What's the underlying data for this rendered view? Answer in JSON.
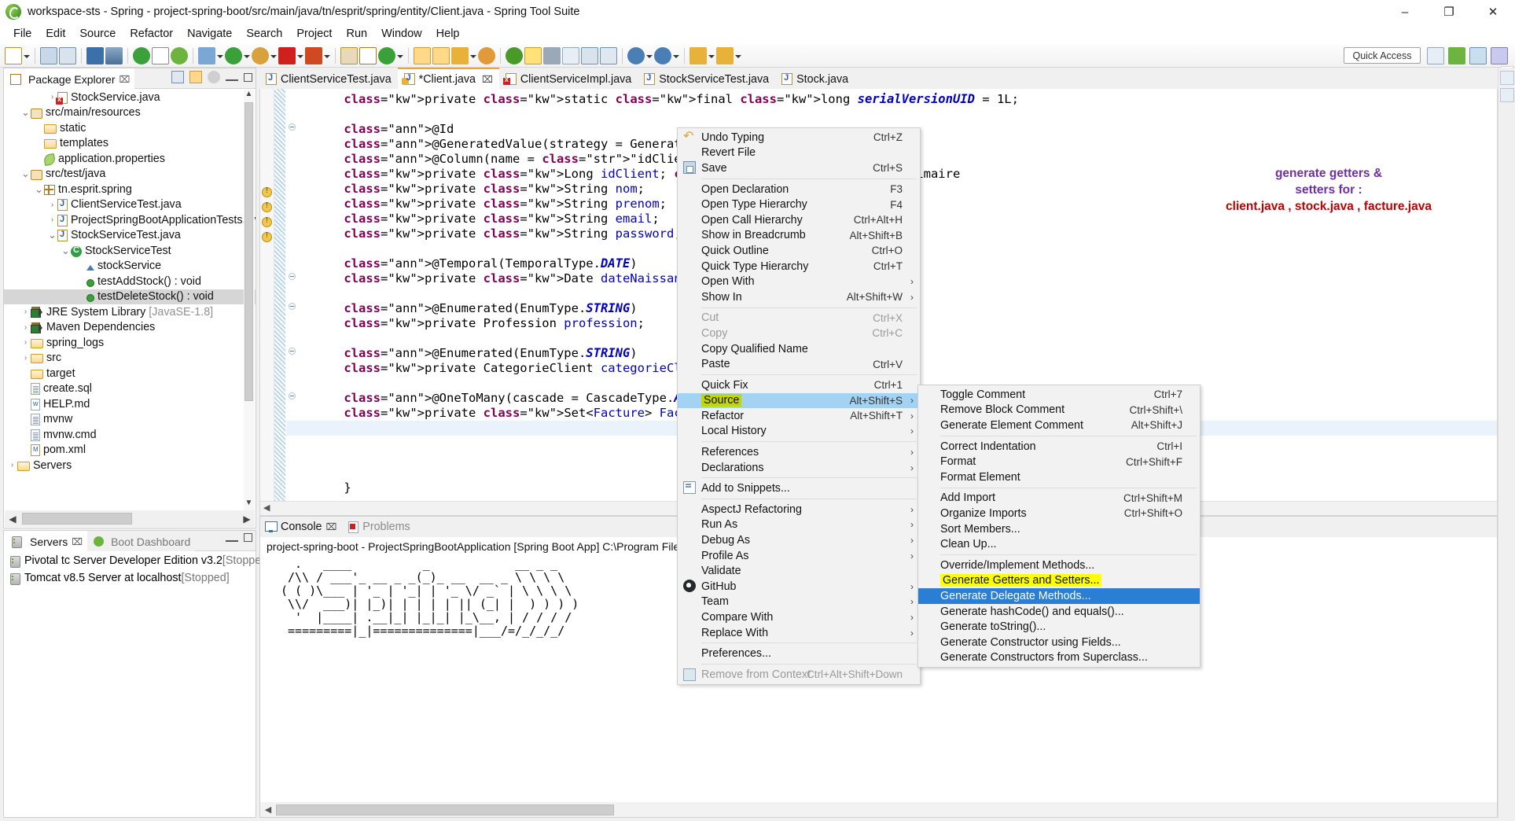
{
  "window": {
    "title": "workspace-sts - Spring - project-spring-boot/src/main/java/tn/esprit/spring/entity/Client.java - Spring Tool Suite",
    "minimize": "–",
    "maximize": "❐",
    "close": "✕"
  },
  "menubar": [
    "File",
    "Edit",
    "Source",
    "Refactor",
    "Navigate",
    "Search",
    "Project",
    "Run",
    "Window",
    "Help"
  ],
  "toolbar": {
    "quick_access": "Quick Access"
  },
  "package_explorer": {
    "tab_label": "Package Explorer",
    "tab_close": "⌧",
    "tree": [
      {
        "indent": 3,
        "twisty": ">",
        "icon": "java-error-icon",
        "label": "StockService.java"
      },
      {
        "indent": 1,
        "twisty": "v",
        "icon": "package-folder-icon",
        "label": "src/main/resources"
      },
      {
        "indent": 2,
        "twisty": "",
        "icon": "folder-open-icon",
        "label": "static"
      },
      {
        "indent": 2,
        "twisty": "",
        "icon": "folder-open-icon",
        "label": "templates"
      },
      {
        "indent": 2,
        "twisty": "",
        "icon": "properties-icon",
        "label": "application.properties"
      },
      {
        "indent": 1,
        "twisty": "v",
        "icon": "package-folder-icon",
        "label": "src/test/java"
      },
      {
        "indent": 2,
        "twisty": "v",
        "icon": "package-icon",
        "label": "tn.esprit.spring"
      },
      {
        "indent": 3,
        "twisty": ">",
        "icon": "java-icon",
        "label": "ClientServiceTest.java"
      },
      {
        "indent": 3,
        "twisty": ">",
        "icon": "java-icon",
        "label": "ProjectSpringBootApplicationTests.java"
      },
      {
        "indent": 3,
        "twisty": "v",
        "icon": "java-icon",
        "label": "StockServiceTest.java"
      },
      {
        "indent": 4,
        "twisty": "v",
        "icon": "class-icon",
        "label": "StockServiceTest"
      },
      {
        "indent": 5,
        "twisty": "",
        "icon": "field-icon",
        "label": "stockService"
      },
      {
        "indent": 5,
        "twisty": "",
        "icon": "method-icon",
        "label": "testAddStock() : void",
        "dim_suffix": ""
      },
      {
        "indent": 5,
        "twisty": "",
        "icon": "method-icon",
        "label": "testDeleteStock() : void",
        "selected": true
      },
      {
        "indent": 1,
        "twisty": ">",
        "icon": "library-icon",
        "label": "JRE System Library ",
        "dim_suffix": "[JavaSE-1.8]"
      },
      {
        "indent": 1,
        "twisty": ">",
        "icon": "library-icon",
        "label": "Maven Dependencies"
      },
      {
        "indent": 1,
        "twisty": ">",
        "icon": "folder-open-icon",
        "label": "spring_logs"
      },
      {
        "indent": 1,
        "twisty": ">",
        "icon": "folder-error-icon",
        "label": "src"
      },
      {
        "indent": 1,
        "twisty": "",
        "icon": "folder-open-icon",
        "label": "target"
      },
      {
        "indent": 1,
        "twisty": "",
        "icon": "file-icon",
        "label": "create.sql"
      },
      {
        "indent": 1,
        "twisty": "",
        "icon": "md-icon",
        "label": "HELP.md"
      },
      {
        "indent": 1,
        "twisty": "",
        "icon": "file-icon",
        "label": "mvnw"
      },
      {
        "indent": 1,
        "twisty": "",
        "icon": "file-icon",
        "label": "mvnw.cmd"
      },
      {
        "indent": 1,
        "twisty": "",
        "icon": "xml-icon",
        "label": "pom.xml"
      },
      {
        "indent": 0,
        "twisty": ">",
        "icon": "folder-open-icon",
        "label": "Servers"
      }
    ]
  },
  "servers_panel": {
    "tabs": [
      {
        "label": "Servers",
        "active": true,
        "close": "⌧"
      },
      {
        "label": "Boot Dashboard",
        "active": false
      }
    ],
    "rows": [
      {
        "name": "Pivotal tc Server Developer Edition v3.2 ",
        "status": "[Stopped]"
      },
      {
        "name": "Tomcat v8.5 Server at localhost ",
        "status": "[Stopped]"
      }
    ]
  },
  "editor": {
    "tabs": [
      {
        "label": "ClientServiceTest.java",
        "icon": "java-icon",
        "active": false,
        "close": false
      },
      {
        "label": "*Client.java",
        "icon": "java-warn-icon",
        "active": true,
        "close": true
      },
      {
        "label": "ClientServiceImpl.java",
        "icon": "java-error-icon",
        "active": false,
        "close": false
      },
      {
        "label": "StockServiceTest.java",
        "icon": "java-icon",
        "active": false,
        "close": false
      },
      {
        "label": "Stock.java",
        "icon": "java-icon",
        "active": false,
        "close": false
      }
    ],
    "code_lines": [
      "    private static final long serialVersionUID = 1L;",
      "",
      "    @Id",
      "    @GeneratedValue(strategy = GenerationType.IDENTITY)",
      "    @Column(name = \"idClient\")",
      "    private Long idClient; // Clé primaire",
      "    private String nom;",
      "    private String prenom;",
      "    private String email;",
      "    private String password;",
      "",
      "    @Temporal(TemporalType.DATE)",
      "    private Date dateNaissance;",
      "",
      "    @Enumerated(EnumType.STRING)",
      "    private Profession profession;",
      "",
      "    @Enumerated(EnumType.STRING)",
      "    private CategorieClient categorieClient;",
      "",
      "    @OneToMany(cascade = CascadeType.ALL, mappedBy = \"Cl",
      "    private Set<Facture> Facture;",
      "",
      "",
      "",
      "",
      "    }"
    ]
  },
  "annotation": {
    "line1": "generate getters &",
    "line2": "setters for :",
    "line3": "client.java , stock.java , facture.java"
  },
  "console": {
    "tabs": [
      {
        "label": "Console",
        "active": true,
        "close": "⌧",
        "icon": "console-icon"
      },
      {
        "label": "Problems",
        "active": false,
        "icon": "problems-icon"
      }
    ],
    "header": "project-spring-boot - ProjectSpringBootApplication [Spring Boot App] C:\\Program Files\\Java\\jdk1",
    "art": [
      "  .   ____          _            __ _ _",
      " /\\\\ / ___'_ __ _ _(_)_ __  __ _ \\ \\ \\ \\",
      "( ( )\\___ | '_ | '_| | '_ \\/ _` | \\ \\ \\ \\",
      " \\\\/  ___)| |_)| | | | | || (_| |  ) ) ) )",
      "  '  |____| .__|_| |_|_| |_\\__, | / / / /",
      " =========|_|==============|___/=/_/_/_/"
    ]
  },
  "context_menu": {
    "items": [
      {
        "label": "Undo Typing",
        "shortcut": "Ctrl+Z",
        "icon": "undo-icon"
      },
      {
        "label": "Revert File",
        "shortcut": ""
      },
      {
        "label": "Save",
        "shortcut": "Ctrl+S",
        "icon": "save-icon"
      },
      {
        "sep": true
      },
      {
        "label": "Open Declaration",
        "shortcut": "F3"
      },
      {
        "label": "Open Type Hierarchy",
        "shortcut": "F4"
      },
      {
        "label": "Open Call Hierarchy",
        "shortcut": "Ctrl+Alt+H"
      },
      {
        "label": "Show in Breadcrumb",
        "shortcut": "Alt+Shift+B"
      },
      {
        "label": "Quick Outline",
        "shortcut": "Ctrl+O"
      },
      {
        "label": "Quick Type Hierarchy",
        "shortcut": "Ctrl+T"
      },
      {
        "label": "Open With",
        "shortcut": "",
        "submenu": true
      },
      {
        "label": "Show In",
        "shortcut": "Alt+Shift+W",
        "submenu": true
      },
      {
        "sep": true
      },
      {
        "label": "Cut",
        "shortcut": "Ctrl+X",
        "disabled": true
      },
      {
        "label": "Copy",
        "shortcut": "Ctrl+C",
        "disabled": true
      },
      {
        "label": "Copy Qualified Name",
        "shortcut": ""
      },
      {
        "label": "Paste",
        "shortcut": "Ctrl+V"
      },
      {
        "sep": true
      },
      {
        "label": "Quick Fix",
        "shortcut": "Ctrl+1"
      },
      {
        "label": "Source",
        "shortcut": "Alt+Shift+S",
        "submenu": true,
        "selected": true,
        "highlight": "green"
      },
      {
        "label": "Refactor",
        "shortcut": "Alt+Shift+T",
        "submenu": true
      },
      {
        "label": "Local History",
        "shortcut": "",
        "submenu": true
      },
      {
        "sep": true
      },
      {
        "label": "References",
        "shortcut": "",
        "submenu": true
      },
      {
        "label": "Declarations",
        "shortcut": "",
        "submenu": true
      },
      {
        "sep": true
      },
      {
        "label": "Add to Snippets...",
        "shortcut": "",
        "icon": "snippet-icon"
      },
      {
        "sep": true
      },
      {
        "label": "AspectJ Refactoring",
        "shortcut": "",
        "submenu": true
      },
      {
        "label": "Run As",
        "shortcut": "",
        "submenu": true
      },
      {
        "label": "Debug As",
        "shortcut": "",
        "submenu": true
      },
      {
        "label": "Profile As",
        "shortcut": "",
        "submenu": true
      },
      {
        "label": "Validate",
        "shortcut": ""
      },
      {
        "label": "GitHub",
        "shortcut": "",
        "submenu": true,
        "icon": "github-icon"
      },
      {
        "label": "Team",
        "shortcut": "",
        "submenu": true
      },
      {
        "label": "Compare With",
        "shortcut": "",
        "submenu": true
      },
      {
        "label": "Replace With",
        "shortcut": "",
        "submenu": true
      },
      {
        "sep": true
      },
      {
        "label": "Preferences...",
        "shortcut": ""
      },
      {
        "sep": true
      },
      {
        "label": "Remove from Context",
        "shortcut": "Ctrl+Alt+Shift+Down",
        "disabled": true,
        "icon": "remove-icon"
      }
    ]
  },
  "source_submenu": {
    "items": [
      {
        "label": "Toggle Comment",
        "shortcut": "Ctrl+7"
      },
      {
        "label": "Remove Block Comment",
        "shortcut": "Ctrl+Shift+\\"
      },
      {
        "label": "Generate Element Comment",
        "shortcut": "Alt+Shift+J"
      },
      {
        "sep": true
      },
      {
        "label": "Correct Indentation",
        "shortcut": "Ctrl+I"
      },
      {
        "label": "Format",
        "shortcut": "Ctrl+Shift+F"
      },
      {
        "label": "Format Element",
        "shortcut": ""
      },
      {
        "sep": true
      },
      {
        "label": "Add Import",
        "shortcut": "Ctrl+Shift+M"
      },
      {
        "label": "Organize Imports",
        "shortcut": "Ctrl+Shift+O"
      },
      {
        "label": "Sort Members...",
        "shortcut": ""
      },
      {
        "label": "Clean Up...",
        "shortcut": ""
      },
      {
        "sep": true
      },
      {
        "label": "Override/Implement Methods...",
        "shortcut": ""
      },
      {
        "label": "Generate Getters and Setters...",
        "shortcut": "",
        "highlight": "yellow"
      },
      {
        "label": "Generate Delegate Methods...",
        "shortcut": "",
        "selected_blue": true
      },
      {
        "label": "Generate hashCode() and equals()...",
        "shortcut": ""
      },
      {
        "label": "Generate toString()...",
        "shortcut": ""
      },
      {
        "label": "Generate Constructor using Fields...",
        "shortcut": ""
      },
      {
        "label": "Generate Constructors from Superclass...",
        "shortcut": ""
      }
    ]
  },
  "colors": {
    "selection_blue": "#2a7fd4",
    "hover_blue": "#a3d2f2",
    "highlight_green": "#c3d600",
    "highlight_yellow": "#ffff00",
    "annotation_red": "#c00000",
    "annotation_purple": "#7030a0"
  }
}
